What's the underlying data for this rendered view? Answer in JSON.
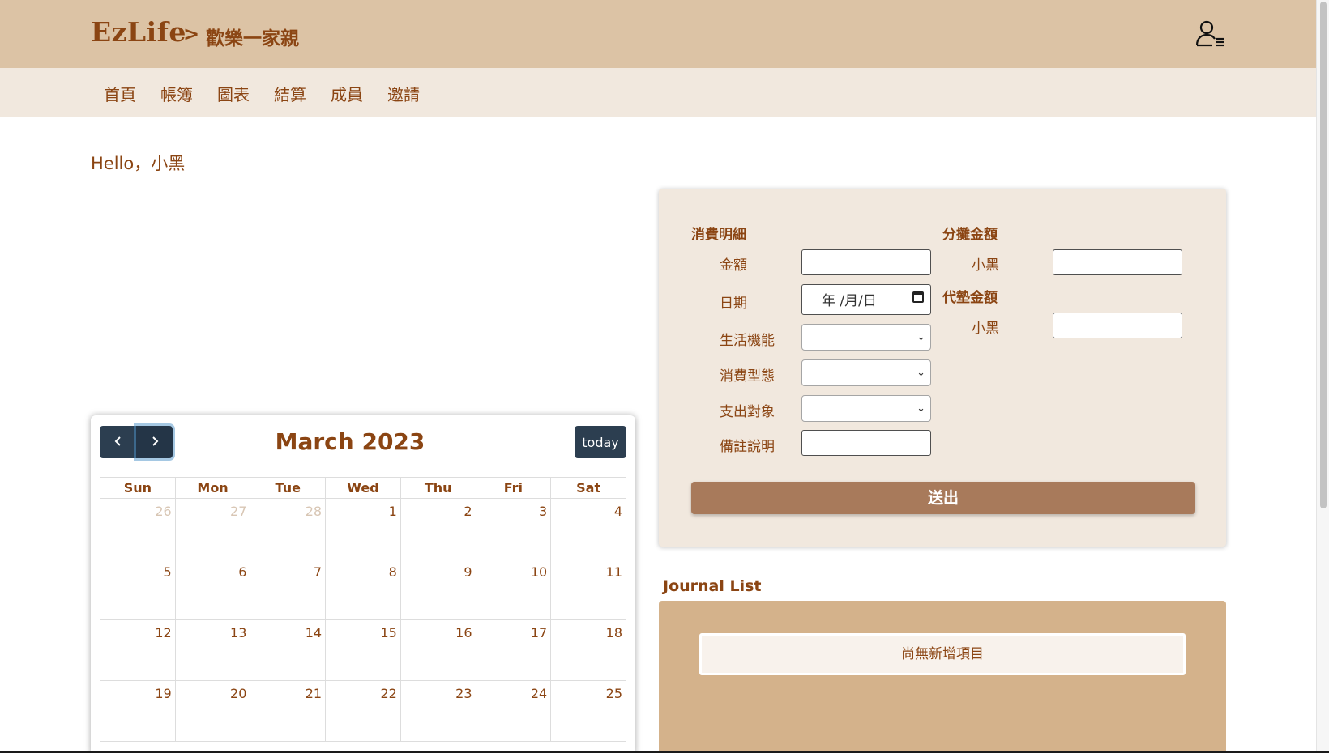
{
  "header": {
    "brand": "EzLife",
    "separator": ">",
    "family_name": "歡樂一家親",
    "user_icon": "user-list-icon"
  },
  "nav": {
    "items": [
      {
        "label": "首頁"
      },
      {
        "label": "帳簿"
      },
      {
        "label": "圖表"
      },
      {
        "label": "結算"
      },
      {
        "label": "成員"
      },
      {
        "label": "邀請"
      }
    ]
  },
  "greeting": "Hello，小黑",
  "calendar": {
    "title": "March 2023",
    "today_label": "today",
    "prev_icon": "chevron-left-icon",
    "next_icon": "chevron-right-icon",
    "weekdays": [
      "Sun",
      "Mon",
      "Tue",
      "Wed",
      "Thu",
      "Fri",
      "Sat"
    ],
    "weeks": [
      [
        "26",
        "27",
        "28",
        "1",
        "2",
        "3",
        "4"
      ],
      [
        "5",
        "6",
        "7",
        "8",
        "9",
        "10",
        "11"
      ],
      [
        "12",
        "13",
        "14",
        "15",
        "16",
        "17",
        "18"
      ],
      [
        "19",
        "20",
        "21",
        "22",
        "23",
        "24",
        "25"
      ]
    ],
    "other_month_days": [
      "26",
      "27",
      "28"
    ]
  },
  "form": {
    "detail_title": "消費明細",
    "amount_label": "金額",
    "amount_value": "",
    "date_label": "日期",
    "date_placeholder": "年 /月/日",
    "category_label": "生活機能",
    "category_value": "",
    "type_label": "消費型態",
    "type_value": "",
    "target_label": "支出對象",
    "target_value": "",
    "note_label": "備註說明",
    "note_value": "",
    "split_title": "分攤金額",
    "split_member": "小黑",
    "split_value": "",
    "advance_title": "代墊金額",
    "advance_member": "小黑",
    "advance_value": "",
    "submit_label": "送出"
  },
  "journal": {
    "title": "Journal List",
    "empty_text": "尚無新增項目"
  }
}
